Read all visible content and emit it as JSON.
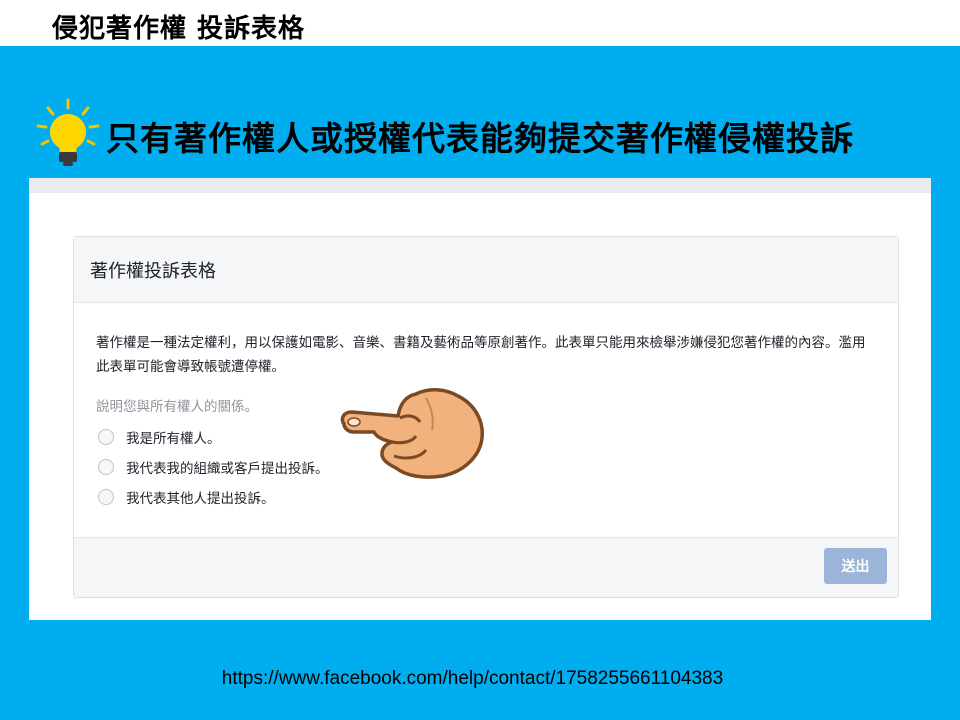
{
  "slide": {
    "title": "侵犯著作權 投訴表格",
    "headline": "只有著作權人或授權代表能夠提交著作權侵權投訴",
    "url": "https://www.facebook.com/help/contact/1758255661104383"
  },
  "form": {
    "title": "著作權投訴表格",
    "description": "著作權是一種法定權利，用以保護如電影、音樂、書籍及藝術品等原創著作。此表單只能用來檢舉涉嫌侵犯您著作權的內容。濫用此表單可能會導致帳號遭停權。",
    "question": "說明您與所有權人的關係。",
    "options": [
      "我是所有權人。",
      "我代表我的組織或客戶提出投訴。",
      "我代表其他人提出投訴。"
    ],
    "submit_label": "送出"
  },
  "colors": {
    "panel": "#00aeef",
    "submit_disabled": "#9cb4d8",
    "bulb": "#ffd700",
    "hand": "#f2b27e"
  },
  "icons": [
    "lightbulb-icon",
    "pointing-hand-icon",
    "radio-icon"
  ]
}
